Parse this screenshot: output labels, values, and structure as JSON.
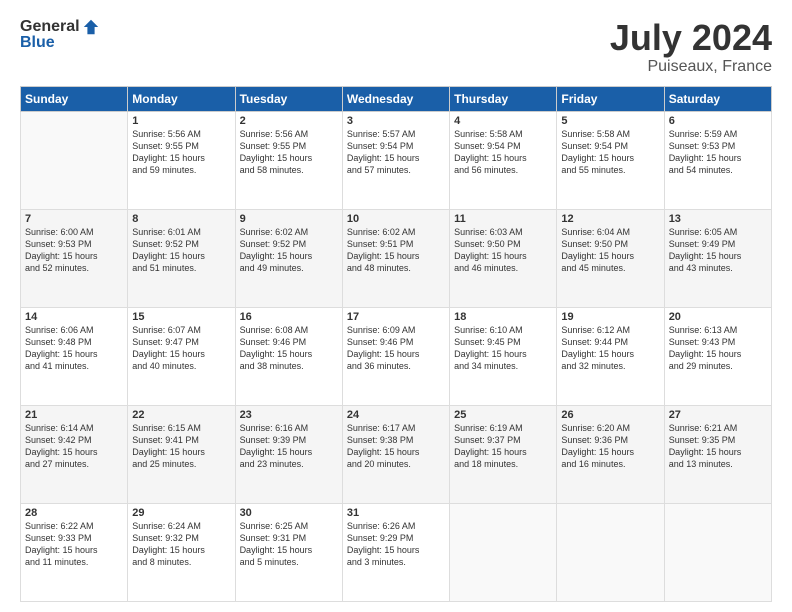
{
  "header": {
    "logo": {
      "general": "General",
      "blue": "Blue"
    },
    "title": "July 2024",
    "subtitle": "Puiseaux, France"
  },
  "calendar": {
    "days_of_week": [
      "Sunday",
      "Monday",
      "Tuesday",
      "Wednesday",
      "Thursday",
      "Friday",
      "Saturday"
    ],
    "weeks": [
      [
        {
          "day": "",
          "info": ""
        },
        {
          "day": "1",
          "info": "Sunrise: 5:56 AM\nSunset: 9:55 PM\nDaylight: 15 hours\nand 59 minutes."
        },
        {
          "day": "2",
          "info": "Sunrise: 5:56 AM\nSunset: 9:55 PM\nDaylight: 15 hours\nand 58 minutes."
        },
        {
          "day": "3",
          "info": "Sunrise: 5:57 AM\nSunset: 9:54 PM\nDaylight: 15 hours\nand 57 minutes."
        },
        {
          "day": "4",
          "info": "Sunrise: 5:58 AM\nSunset: 9:54 PM\nDaylight: 15 hours\nand 56 minutes."
        },
        {
          "day": "5",
          "info": "Sunrise: 5:58 AM\nSunset: 9:54 PM\nDaylight: 15 hours\nand 55 minutes."
        },
        {
          "day": "6",
          "info": "Sunrise: 5:59 AM\nSunset: 9:53 PM\nDaylight: 15 hours\nand 54 minutes."
        }
      ],
      [
        {
          "day": "7",
          "info": "Sunrise: 6:00 AM\nSunset: 9:53 PM\nDaylight: 15 hours\nand 52 minutes."
        },
        {
          "day": "8",
          "info": "Sunrise: 6:01 AM\nSunset: 9:52 PM\nDaylight: 15 hours\nand 51 minutes."
        },
        {
          "day": "9",
          "info": "Sunrise: 6:02 AM\nSunset: 9:52 PM\nDaylight: 15 hours\nand 49 minutes."
        },
        {
          "day": "10",
          "info": "Sunrise: 6:02 AM\nSunset: 9:51 PM\nDaylight: 15 hours\nand 48 minutes."
        },
        {
          "day": "11",
          "info": "Sunrise: 6:03 AM\nSunset: 9:50 PM\nDaylight: 15 hours\nand 46 minutes."
        },
        {
          "day": "12",
          "info": "Sunrise: 6:04 AM\nSunset: 9:50 PM\nDaylight: 15 hours\nand 45 minutes."
        },
        {
          "day": "13",
          "info": "Sunrise: 6:05 AM\nSunset: 9:49 PM\nDaylight: 15 hours\nand 43 minutes."
        }
      ],
      [
        {
          "day": "14",
          "info": "Sunrise: 6:06 AM\nSunset: 9:48 PM\nDaylight: 15 hours\nand 41 minutes."
        },
        {
          "day": "15",
          "info": "Sunrise: 6:07 AM\nSunset: 9:47 PM\nDaylight: 15 hours\nand 40 minutes."
        },
        {
          "day": "16",
          "info": "Sunrise: 6:08 AM\nSunset: 9:46 PM\nDaylight: 15 hours\nand 38 minutes."
        },
        {
          "day": "17",
          "info": "Sunrise: 6:09 AM\nSunset: 9:46 PM\nDaylight: 15 hours\nand 36 minutes."
        },
        {
          "day": "18",
          "info": "Sunrise: 6:10 AM\nSunset: 9:45 PM\nDaylight: 15 hours\nand 34 minutes."
        },
        {
          "day": "19",
          "info": "Sunrise: 6:12 AM\nSunset: 9:44 PM\nDaylight: 15 hours\nand 32 minutes."
        },
        {
          "day": "20",
          "info": "Sunrise: 6:13 AM\nSunset: 9:43 PM\nDaylight: 15 hours\nand 29 minutes."
        }
      ],
      [
        {
          "day": "21",
          "info": "Sunrise: 6:14 AM\nSunset: 9:42 PM\nDaylight: 15 hours\nand 27 minutes."
        },
        {
          "day": "22",
          "info": "Sunrise: 6:15 AM\nSunset: 9:41 PM\nDaylight: 15 hours\nand 25 minutes."
        },
        {
          "day": "23",
          "info": "Sunrise: 6:16 AM\nSunset: 9:39 PM\nDaylight: 15 hours\nand 23 minutes."
        },
        {
          "day": "24",
          "info": "Sunrise: 6:17 AM\nSunset: 9:38 PM\nDaylight: 15 hours\nand 20 minutes."
        },
        {
          "day": "25",
          "info": "Sunrise: 6:19 AM\nSunset: 9:37 PM\nDaylight: 15 hours\nand 18 minutes."
        },
        {
          "day": "26",
          "info": "Sunrise: 6:20 AM\nSunset: 9:36 PM\nDaylight: 15 hours\nand 16 minutes."
        },
        {
          "day": "27",
          "info": "Sunrise: 6:21 AM\nSunset: 9:35 PM\nDaylight: 15 hours\nand 13 minutes."
        }
      ],
      [
        {
          "day": "28",
          "info": "Sunrise: 6:22 AM\nSunset: 9:33 PM\nDaylight: 15 hours\nand 11 minutes."
        },
        {
          "day": "29",
          "info": "Sunrise: 6:24 AM\nSunset: 9:32 PM\nDaylight: 15 hours\nand 8 minutes."
        },
        {
          "day": "30",
          "info": "Sunrise: 6:25 AM\nSunset: 9:31 PM\nDaylight: 15 hours\nand 5 minutes."
        },
        {
          "day": "31",
          "info": "Sunrise: 6:26 AM\nSunset: 9:29 PM\nDaylight: 15 hours\nand 3 minutes."
        },
        {
          "day": "",
          "info": ""
        },
        {
          "day": "",
          "info": ""
        },
        {
          "day": "",
          "info": ""
        }
      ]
    ]
  }
}
